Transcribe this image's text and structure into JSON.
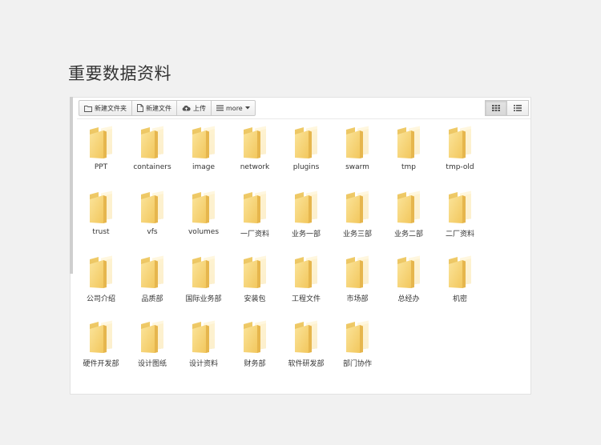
{
  "page": {
    "title": "重要数据资料"
  },
  "toolbar": {
    "new_folder_label": "新建文件夹",
    "new_file_label": "新建文件",
    "upload_label": "上传",
    "more_label": "more"
  },
  "icons": {
    "new_folder": "folder-outline-icon",
    "new_file": "file-outline-icon",
    "upload": "cloud-upload-icon",
    "more": "list-icon",
    "grid_view": "grid-view-icon",
    "list_view": "list-view-icon",
    "folder": "folder-icon"
  },
  "colors": {
    "folder_front": "#f7d77b",
    "folder_back": "#e9bd4c",
    "panel_border": "#e2e2e2"
  },
  "folders": [
    {
      "label": "PPT"
    },
    {
      "label": "containers"
    },
    {
      "label": "image"
    },
    {
      "label": "network"
    },
    {
      "label": "plugins"
    },
    {
      "label": "swarm"
    },
    {
      "label": "tmp"
    },
    {
      "label": "tmp-old"
    },
    {
      "label": "trust"
    },
    {
      "label": "vfs"
    },
    {
      "label": "volumes"
    },
    {
      "label": "一厂资料"
    },
    {
      "label": "业务一部"
    },
    {
      "label": "业务三部"
    },
    {
      "label": "业务二部"
    },
    {
      "label": "二厂资料"
    },
    {
      "label": "公司介绍"
    },
    {
      "label": "品质部"
    },
    {
      "label": "国际业务部"
    },
    {
      "label": "安装包"
    },
    {
      "label": "工程文件"
    },
    {
      "label": "市场部"
    },
    {
      "label": "总经办"
    },
    {
      "label": "机密"
    },
    {
      "label": "硬件开发部"
    },
    {
      "label": "设计图纸"
    },
    {
      "label": "设计资料"
    },
    {
      "label": "财务部"
    },
    {
      "label": "软件研发部"
    },
    {
      "label": "部门协作"
    }
  ]
}
